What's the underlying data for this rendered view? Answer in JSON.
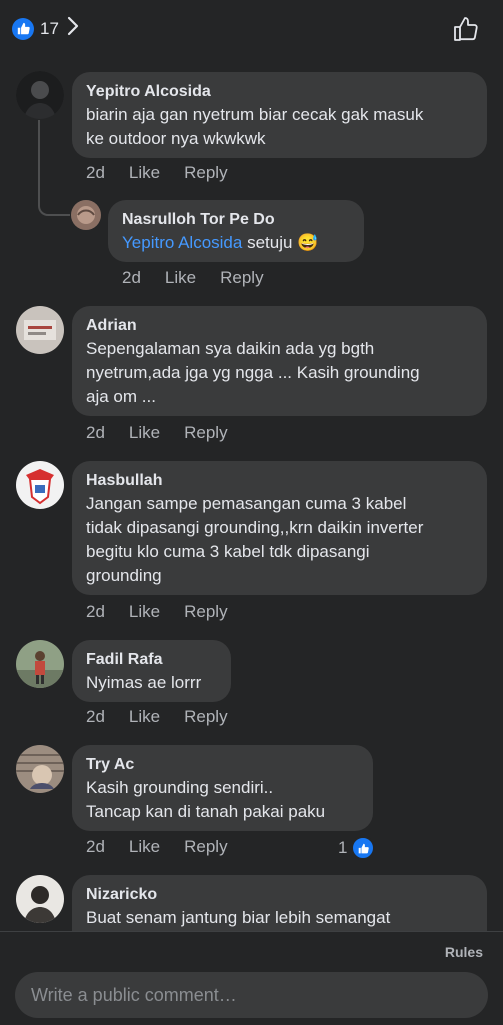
{
  "header": {
    "like_count": "17"
  },
  "comments": [
    {
      "author": "Yepitro Alcosida",
      "text": "biarin aja gan nyetrum biar cecak gak masuk\nke outdoor nya wkwkwk",
      "time": "2d",
      "like": "Like",
      "reply": "Reply"
    },
    {
      "author": "Nasrulloh Tor Pe Do",
      "mention": "Yepitro Alcosida",
      "text": " setuju 😅",
      "time": "2d",
      "like": "Like",
      "reply": "Reply"
    },
    {
      "author": "Adrian",
      "text": "Sepengalaman sya daikin ada yg bgth\nnyetrum,ada jga yg ngga ... Kasih grounding\naja om ...",
      "time": "2d",
      "like": "Like",
      "reply": "Reply"
    },
    {
      "author": "Hasbullah",
      "text": "Jangan sampe pemasangan cuma 3 kabel\ntidak dipasangi grounding,,krn daikin inverter\nbegitu klo cuma 3 kabel tdk dipasangi\ngrounding",
      "time": "2d",
      "like": "Like",
      "reply": "Reply"
    },
    {
      "author": "Fadil Rafa",
      "text": "Nyimas ae lorrr",
      "time": "2d",
      "like": "Like",
      "reply": "Reply"
    },
    {
      "author": "Try Ac",
      "text": "Kasih grounding sendiri..\nTancap kan di tanah pakai paku",
      "time": "2d",
      "like": "Like",
      "reply": "Reply",
      "reaction_count": "1"
    },
    {
      "author": "Nizaricko",
      "text": "Buat senam jantung biar lebih semangat"
    }
  ],
  "footer": {
    "rules": "Rules",
    "placeholder": "Write a public comment…"
  },
  "colors": {
    "background": "#242526",
    "bubble": "#3a3b3c",
    "accent": "#1877f2",
    "mention": "#4599ff",
    "secondary_text": "#b0b3b8"
  },
  "icons": [
    "like-thumb-icon",
    "chevron-right-icon",
    "thumbs-up-outline-icon"
  ]
}
